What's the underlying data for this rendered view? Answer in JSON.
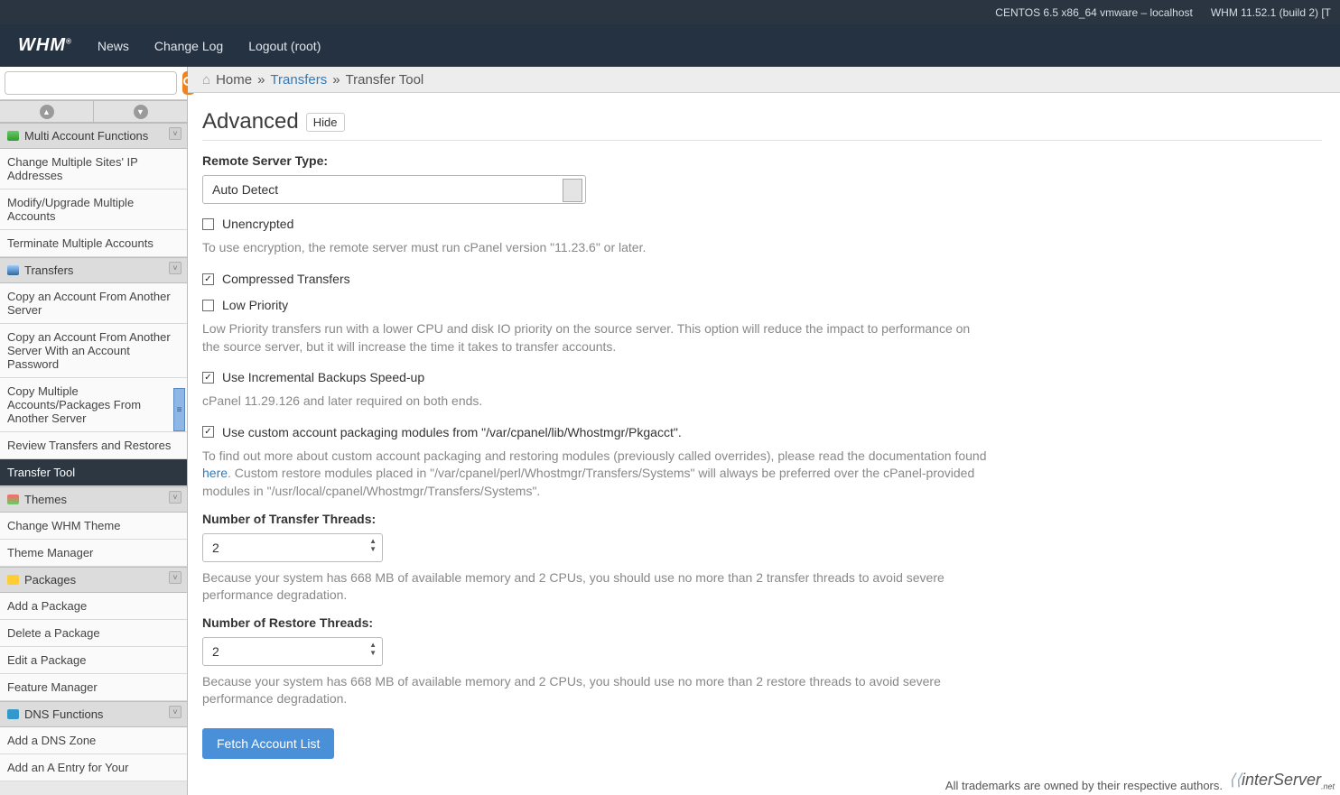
{
  "topbar": {
    "sysinfo": "CENTOS 6.5 x86_64 vmware – localhost",
    "version": "WHM 11.52.1 (build 2) [T"
  },
  "header": {
    "logo": "WHM",
    "news": "News",
    "changelog": "Change Log",
    "logout": "Logout (root)"
  },
  "search": {
    "placeholder": ""
  },
  "breadcrumb": {
    "home": "Home",
    "sep": "»",
    "transfers": "Transfers",
    "current": "Transfer Tool"
  },
  "page": {
    "title": "Advanced",
    "hide": "Hide",
    "remote_label": "Remote Server Type:",
    "remote_value": "Auto Detect",
    "unencrypted": "Unencrypted",
    "unencrypted_help": "To use encryption, the remote server must run cPanel version \"11.23.6\" or later.",
    "compressed": "Compressed Transfers",
    "lowpriority": "Low Priority",
    "lowpriority_help": "Low Priority transfers run with a lower CPU and disk IO priority on the source server. This option will reduce the impact to performance on the source server, but it will increase the time it takes to transfer accounts.",
    "incremental": "Use Incremental Backups Speed-up",
    "incremental_help": "cPanel 11.29.126 and later required on both ends.",
    "custompkg": "Use custom account packaging modules from \"/var/cpanel/lib/Whostmgr/Pkgacct\".",
    "custompkg_help1": "To find out more about custom account packaging and restoring modules (previously called overrides), please read the documentation found ",
    "custompkg_link": "here",
    "custompkg_help2": ". Custom restore modules placed in \"/var/cpanel/perl/Whostmgr/Transfers/Systems\" will always be preferred over the cPanel-provided modules in \"/usr/local/cpanel/Whostmgr/Transfers/Systems\".",
    "threads_label": "Number of Transfer Threads:",
    "threads_value": "2",
    "threads_help": "Because your system has 668 MB of available memory and 2 CPUs, you should use no more than 2 transfer threads to avoid severe performance degradation.",
    "restore_label": "Number of Restore Threads:",
    "restore_value": "2",
    "restore_help": "Because your system has 668 MB of available memory and 2 CPUs, you should use no more than 2 restore threads to avoid severe performance degradation.",
    "fetch": "Fetch Account List"
  },
  "sidebar": {
    "sections": {
      "multiacct": "Multi Account Functions",
      "transfers": "Transfers",
      "themes": "Themes",
      "packages": "Packages",
      "dns": "DNS Functions"
    },
    "items": {
      "changemulti": "Change Multiple Sites' IP Addresses",
      "modify": "Modify/Upgrade Multiple Accounts",
      "terminate": "Terminate Multiple Accounts",
      "copyacct": "Copy an Account From Another Server",
      "copyacctpw": "Copy an Account From Another Server With an Account Password",
      "copymulti": "Copy Multiple Accounts/Packages From Another Server",
      "review": "Review Transfers and Restores",
      "transfertool": "Transfer Tool",
      "changewhm": "Change WHM Theme",
      "thememgr": "Theme Manager",
      "addpkg": "Add a Package",
      "delpkg": "Delete a Package",
      "editpkg": "Edit a Package",
      "featmgr": "Feature Manager",
      "adddns": "Add a DNS Zone",
      "addentry": "Add an A Entry for Your"
    }
  },
  "footer": {
    "trademark": "All trademarks are owned by their respective authors.",
    "inter": "interServer",
    "net": ".net"
  }
}
